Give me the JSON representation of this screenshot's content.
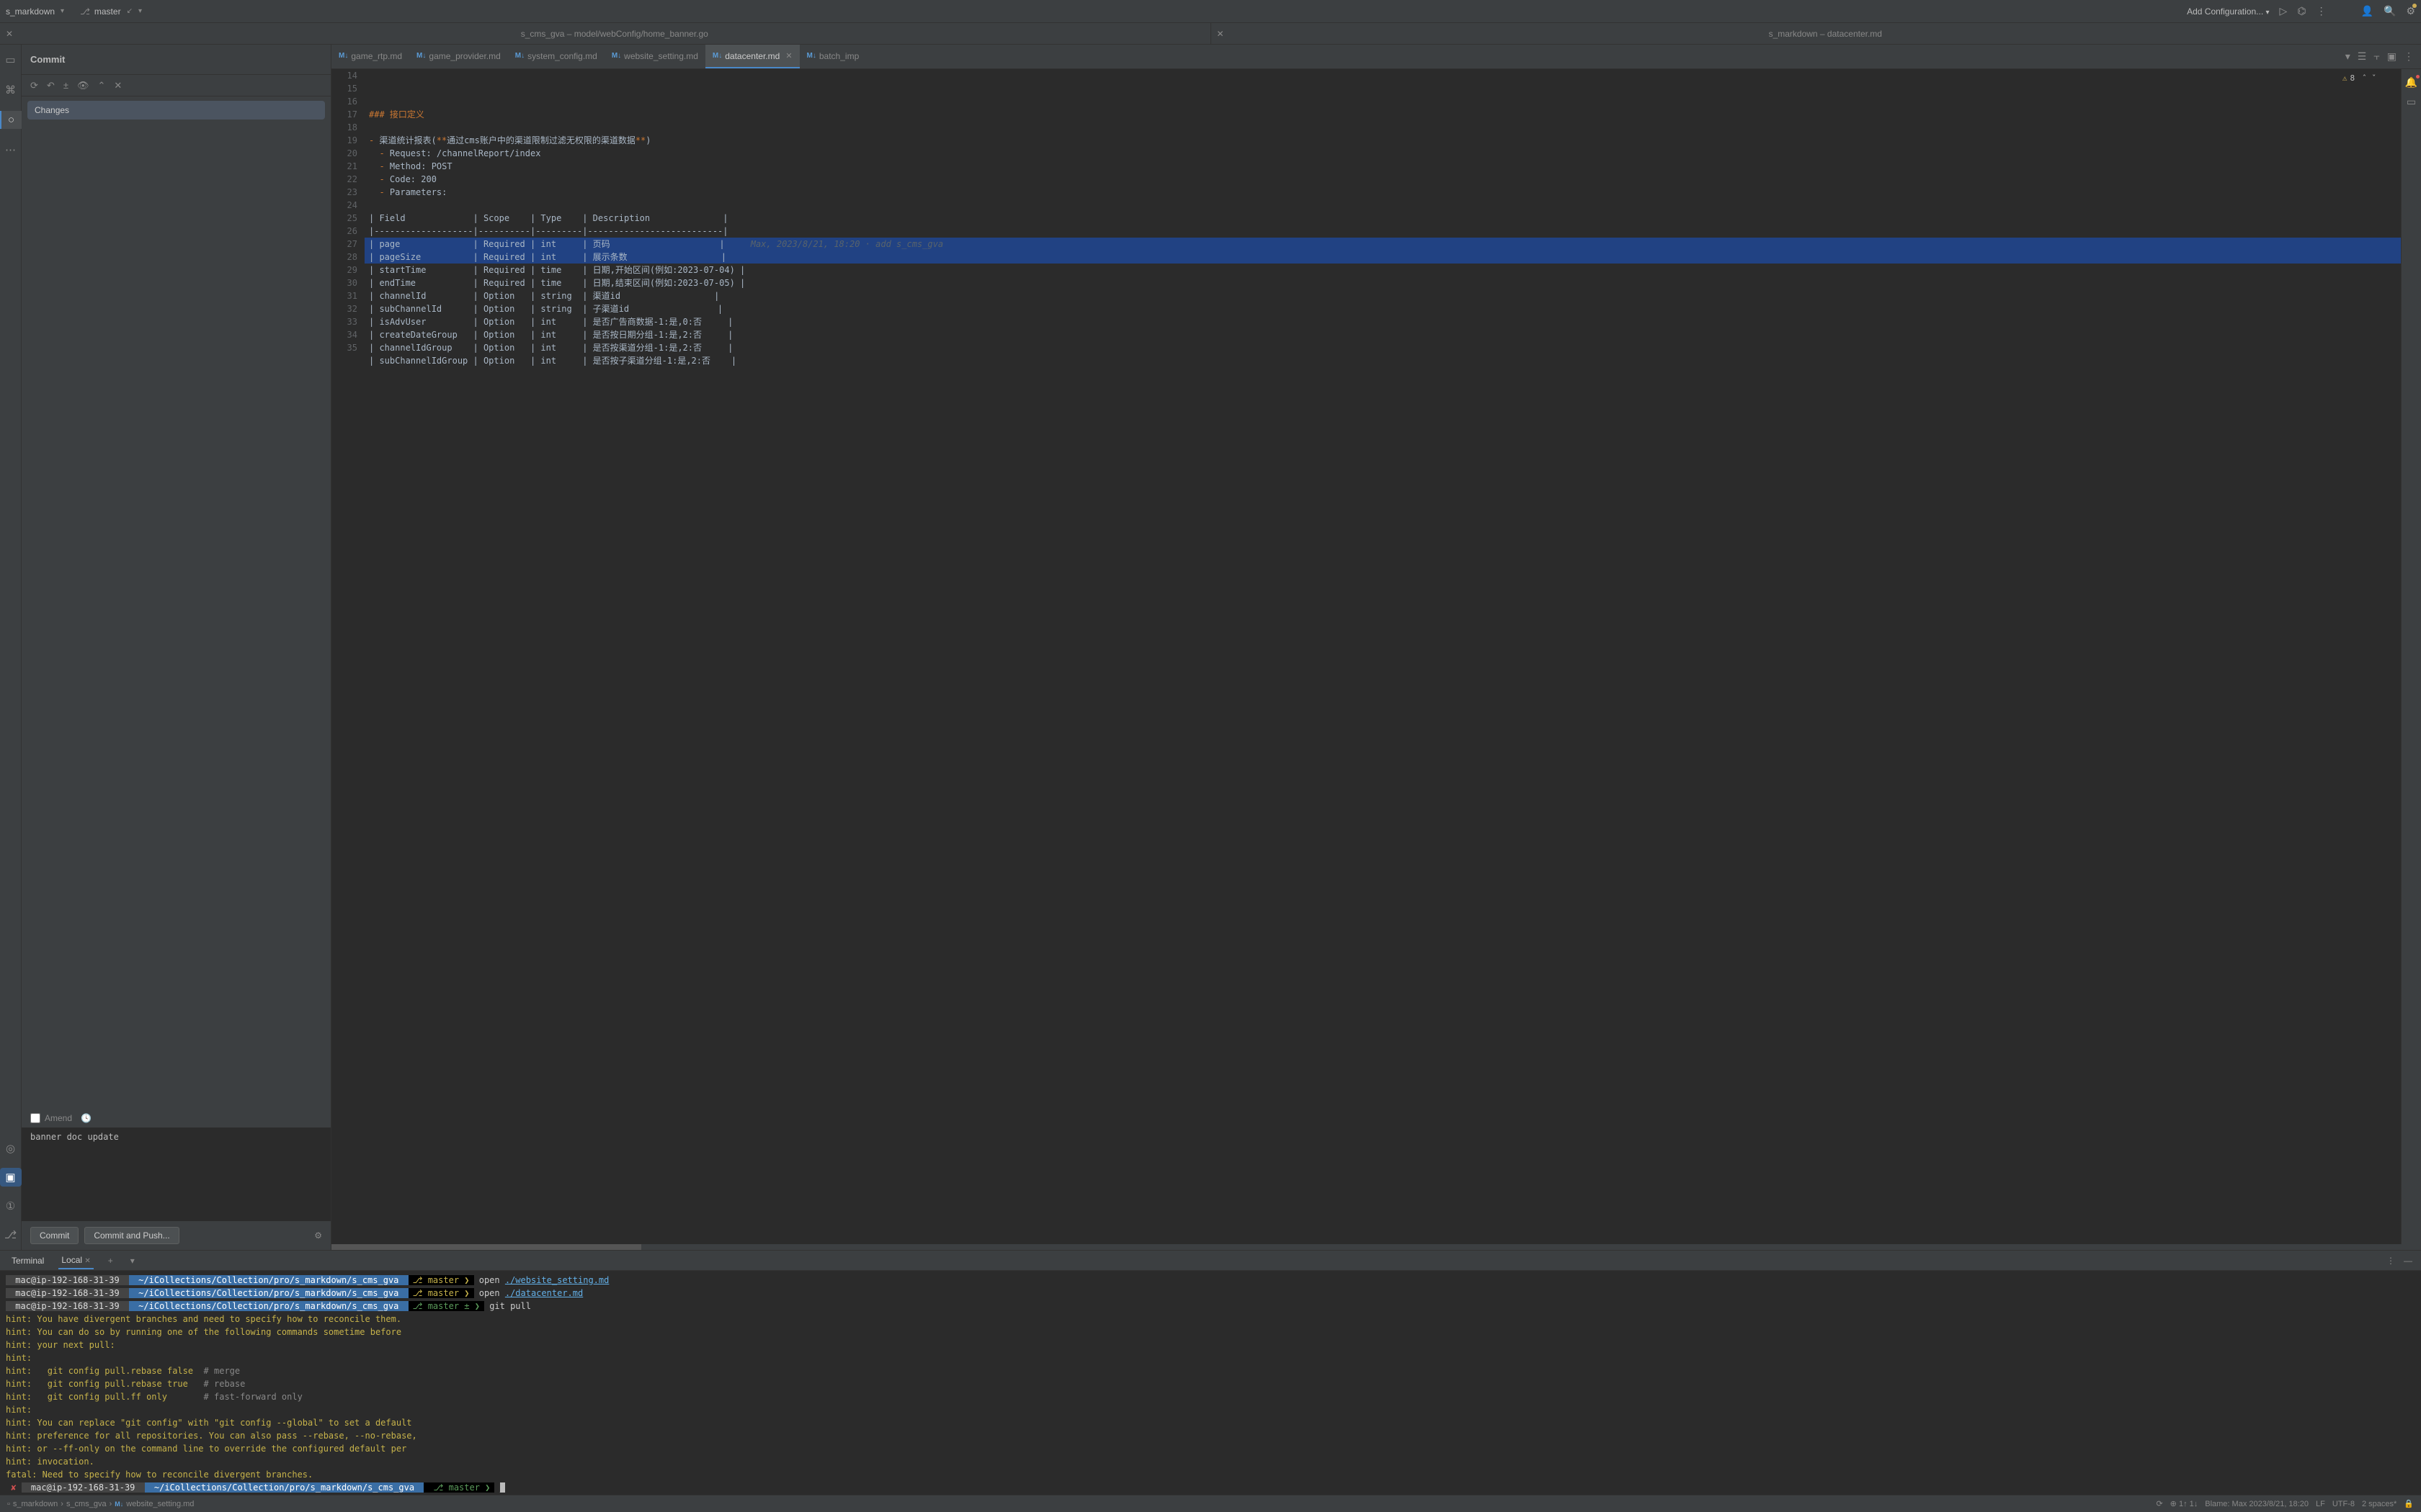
{
  "titleBar": {
    "project": "s_markdown",
    "branch": "master",
    "configLabel": "Add Configuration..."
  },
  "editorGroups": [
    {
      "title": "s_cms_gva – model/webConfig/home_banner.go"
    },
    {
      "title": "s_markdown – datacenter.md"
    }
  ],
  "commitPanel": {
    "header": "Commit",
    "changesLabel": "Changes",
    "amendLabel": "Amend",
    "commitMessage": "banner doc update",
    "commitBtn": "Commit",
    "commitPushBtn": "Commit and Push..."
  },
  "fileTabs": [
    {
      "label": "game_rtp.md",
      "active": false
    },
    {
      "label": "game_provider.md",
      "active": false
    },
    {
      "label": "system_config.md",
      "active": false
    },
    {
      "label": "website_setting.md",
      "active": false
    },
    {
      "label": "datacenter.md",
      "active": true,
      "closable": true
    },
    {
      "label": "batch_imp",
      "active": false
    }
  ],
  "warnings": {
    "count": "8"
  },
  "code": {
    "startLine": 14,
    "lines": [
      {
        "type": "heading",
        "text": "### 接口定义"
      },
      {
        "type": "blank",
        "text": ""
      },
      {
        "type": "list",
        "bullet": "-",
        "text": " 渠道统计报表(**通过cms账户中的渠道限制过滤无权限的渠道数据**)"
      },
      {
        "type": "sub",
        "bullet": "  -",
        "text": " Request: /channelReport/index"
      },
      {
        "type": "sub",
        "bullet": "  -",
        "text": " Method: POST"
      },
      {
        "type": "sub",
        "bullet": "  -",
        "text": " Code: 200"
      },
      {
        "type": "sub",
        "bullet": "  -",
        "text": " Parameters:"
      },
      {
        "type": "blank",
        "text": ""
      },
      {
        "type": "table",
        "text": "| Field             | Scope    | Type    | Description              |"
      },
      {
        "type": "table",
        "text": "|-------------------|----------|---------|--------------------------|"
      },
      {
        "type": "tablesel",
        "text": "| page              | Required | int     | 页码                     |",
        "blame": "Max, 2023/8/21, 18:20 · add s_cms_gva"
      },
      {
        "type": "tablesel",
        "text": "| pageSize          | Required | int     | 展示条数                  |"
      },
      {
        "type": "table",
        "text": "| startTime         | Required | time    | 日期,开始区间(例如:2023-07-04) |"
      },
      {
        "type": "table",
        "text": "| endTime           | Required | time    | 日期,结束区间(例如:2023-07-05) |"
      },
      {
        "type": "table",
        "text": "| channelId         | Option   | string  | 渠道id                  |"
      },
      {
        "type": "table",
        "text": "| subChannelId      | Option   | string  | 子渠道id                 |"
      },
      {
        "type": "table",
        "text": "| isAdvUser         | Option   | int     | 是否广告商数据-1:是,0:否     |"
      },
      {
        "type": "table",
        "text": "| createDateGroup   | Option   | int     | 是否按日期分组-1:是,2:否     |"
      },
      {
        "type": "table",
        "text": "| channelIdGroup    | Option   | int     | 是否按渠道分组-1:是,2:否     |"
      },
      {
        "type": "table",
        "text": "| subChannelIdGroup | Option   | int     | 是否按子渠道分组-1:是,2:否    |"
      },
      {
        "type": "blank",
        "text": ""
      },
      {
        "type": "blank",
        "text": ""
      }
    ]
  },
  "terminal": {
    "tab1": "Terminal",
    "tab2": "Local",
    "prompt": {
      "host": "mac@ip-192-168-31-39",
      "path": "~/iCollections/Collection/pro/s_markdown/s_cms_gva",
      "branchY": "⎇ master",
      "branchG": "⎇ master ±"
    },
    "lines": [
      {
        "seg": "y",
        "cmd": "open ",
        "file": "./website_setting.md"
      },
      {
        "seg": "y",
        "cmd": "open ",
        "file": "./datacenter.md"
      },
      {
        "seg": "g",
        "cmd": "git pull",
        "file": ""
      }
    ],
    "hints": [
      "hint: You have divergent branches and need to specify how to reconcile them.",
      "hint: You can do so by running one of the following commands sometime before",
      "hint: your next pull:",
      "hint:",
      "hint:   git config pull.rebase false  # merge",
      "hint:   git config pull.rebase true   # rebase",
      "hint:   git config pull.ff only       # fast-forward only",
      "hint:",
      "hint: You can replace \"git config\" with \"git config --global\" to set a default",
      "hint: preference for all repositories. You can also pass --rebase, --no-rebase,",
      "hint: or --ff-only on the command line to override the configured default per",
      "hint: invocation.",
      "fatal: Need to specify how to reconcile divergent branches."
    ],
    "finalBranch": "⎇ master"
  },
  "statusBar": {
    "crumb1": "s_markdown",
    "crumb2": "s_cms_gva",
    "crumb3": "website_setting.md",
    "gitStat": "1↑ 1↓",
    "blame": "Blame: Max 2023/8/21, 18:20",
    "lf": "LF",
    "enc": "UTF-8",
    "indent": "2 spaces*"
  }
}
